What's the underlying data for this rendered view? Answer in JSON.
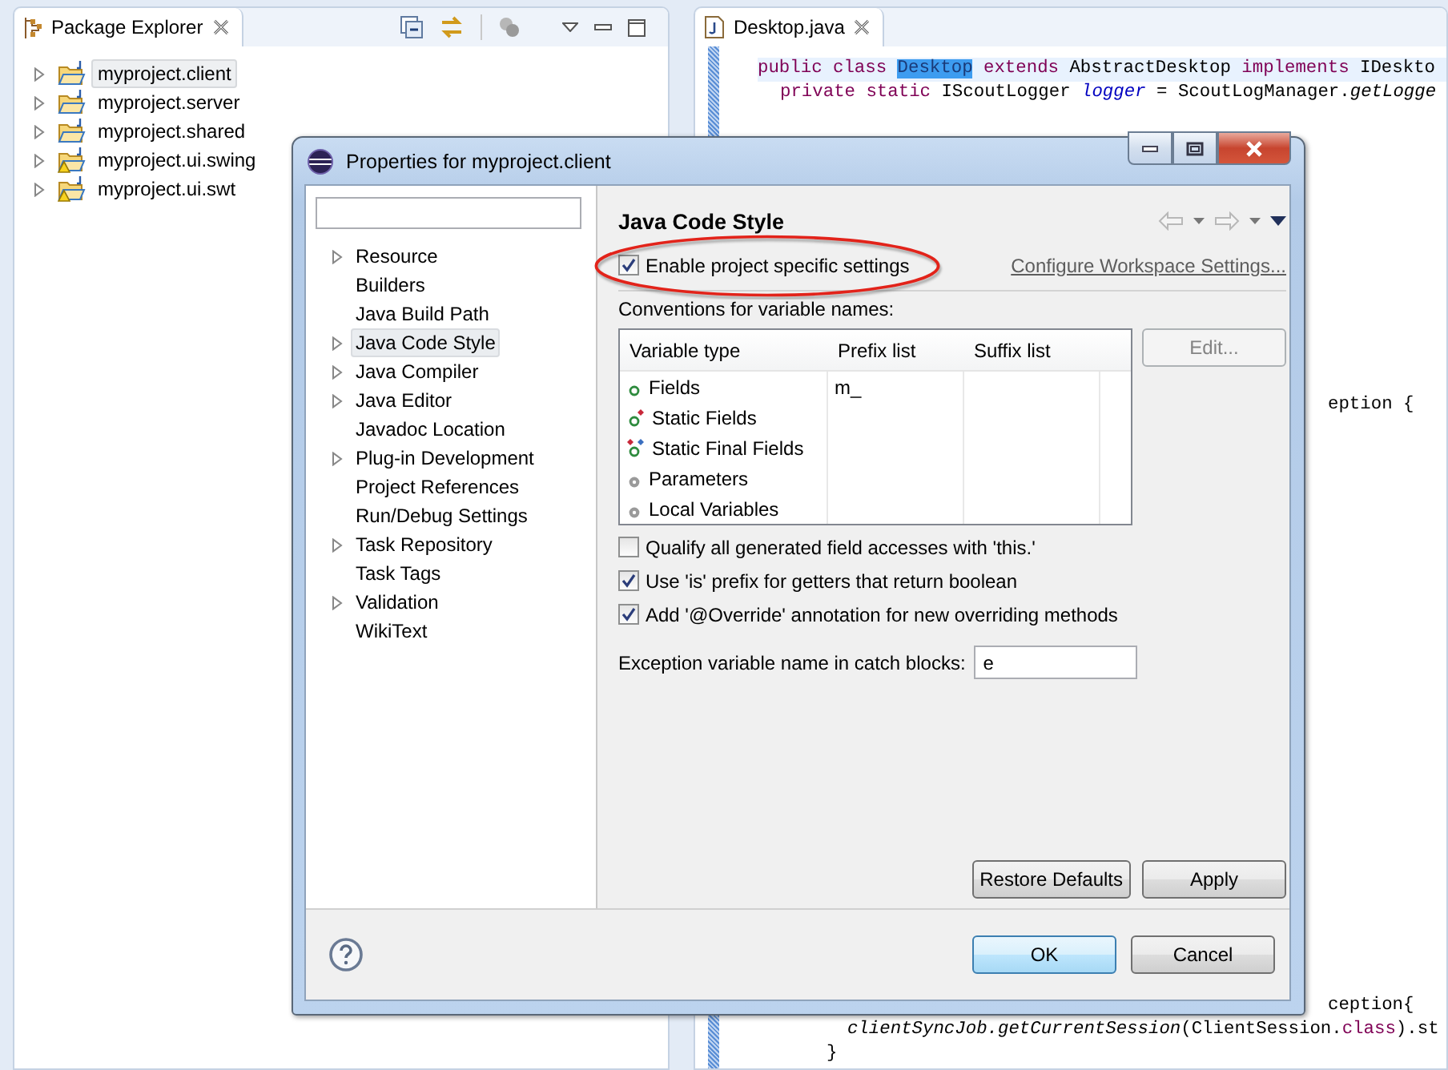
{
  "package_explorer": {
    "title": "Package Explorer",
    "items": [
      {
        "label": "myproject.client",
        "selected": true,
        "warning": false
      },
      {
        "label": "myproject.server",
        "selected": false,
        "warning": false
      },
      {
        "label": "myproject.shared",
        "selected": false,
        "warning": false
      },
      {
        "label": "myproject.ui.swing",
        "selected": false,
        "warning": true
      },
      {
        "label": "myproject.ui.swt",
        "selected": false,
        "warning": true
      }
    ]
  },
  "editor": {
    "tab": "Desktop.java",
    "lines": [
      {
        "current": true,
        "tokens": [
          {
            "kind": "keyword",
            "text": "public class "
          },
          {
            "kind": "selection",
            "text": "Desktop"
          },
          {
            "kind": "keyword",
            "text": " extends "
          },
          {
            "kind": "plain",
            "text": "AbstractDesktop "
          },
          {
            "kind": "keyword",
            "text": "implements "
          },
          {
            "kind": "plain",
            "text": "IDeskto"
          }
        ]
      },
      {
        "current": false,
        "tokens": [
          {
            "kind": "keyword",
            "text": "private static "
          },
          {
            "kind": "plain",
            "text": "IScoutLogger "
          },
          {
            "kind": "field",
            "text": "logger"
          },
          {
            "kind": "plain",
            "text": " = ScoutLogManager."
          },
          {
            "kind": "static-call",
            "text": "getLogge"
          }
        ]
      },
      {
        "current": false,
        "tokens": [
          {
            "kind": "plain",
            "text": "eption {"
          }
        ]
      },
      {
        "current": false,
        "tokens": [
          {
            "kind": "plain",
            "text": "ception{"
          }
        ]
      },
      {
        "current": false,
        "tokens": [
          {
            "kind": "static-call",
            "text": "clientSyncJob.getCurrentSession"
          },
          {
            "kind": "plain",
            "text": "(ClientSession."
          },
          {
            "kind": "keyword",
            "text": "class"
          },
          {
            "kind": "plain",
            "text": ").st"
          }
        ]
      },
      {
        "current": false,
        "tokens": [
          {
            "kind": "plain",
            "text": "}"
          }
        ]
      }
    ]
  },
  "dialog": {
    "title": "Properties for myproject.client",
    "tree": [
      {
        "label": "Resource",
        "has_children": true,
        "selected": false
      },
      {
        "label": "Builders",
        "has_children": false,
        "selected": false
      },
      {
        "label": "Java Build Path",
        "has_children": false,
        "selected": false
      },
      {
        "label": "Java Code Style",
        "has_children": true,
        "selected": true
      },
      {
        "label": "Java Compiler",
        "has_children": true,
        "selected": false
      },
      {
        "label": "Java Editor",
        "has_children": true,
        "selected": false
      },
      {
        "label": "Javadoc Location",
        "has_children": false,
        "selected": false
      },
      {
        "label": "Plug-in Development",
        "has_children": true,
        "selected": false
      },
      {
        "label": "Project References",
        "has_children": false,
        "selected": false
      },
      {
        "label": "Run/Debug Settings",
        "has_children": false,
        "selected": false
      },
      {
        "label": "Task Repository",
        "has_children": true,
        "selected": false
      },
      {
        "label": "Task Tags",
        "has_children": false,
        "selected": false
      },
      {
        "label": "Validation",
        "has_children": true,
        "selected": false
      },
      {
        "label": "WikiText",
        "has_children": false,
        "selected": false
      }
    ],
    "page_title": "Java Code Style",
    "project_specific": {
      "label": "Enable project specific settings",
      "checked": true
    },
    "configure_link": "Configure Workspace Settings...",
    "annotation": {
      "kind": "ellipse"
    },
    "conventions_label": "Conventions for variable names:",
    "table": {
      "columns": [
        "Variable type",
        "Prefix list",
        "Suffix list"
      ],
      "rows": [
        {
          "kind": "field",
          "name": "Fields",
          "prefix": "m_",
          "suffix": ""
        },
        {
          "kind": "static",
          "name": "Static Fields",
          "prefix": "",
          "suffix": ""
        },
        {
          "kind": "static-final",
          "name": "Static Final Fields",
          "prefix": "",
          "suffix": ""
        },
        {
          "kind": "parameter",
          "name": "Parameters",
          "prefix": "",
          "suffix": ""
        },
        {
          "kind": "local",
          "name": "Local Variables",
          "prefix": "",
          "suffix": ""
        }
      ]
    },
    "edit_button": {
      "label": "Edit...",
      "disabled": true
    },
    "options": [
      {
        "label": "Qualify all generated field accesses with 'this.'",
        "checked": false
      },
      {
        "label": "Use 'is' prefix for getters that return boolean",
        "checked": true
      },
      {
        "label": "Add '@Override' annotation for new overriding methods",
        "checked": true
      }
    ],
    "exception_label": "Exception variable name in catch blocks:",
    "exception_value": "e",
    "page_buttons": [
      {
        "label": "Restore Defaults",
        "default": false
      },
      {
        "label": "Apply",
        "default": false
      }
    ],
    "buttons": [
      {
        "label": "OK",
        "default": true
      },
      {
        "label": "Cancel",
        "default": false
      }
    ]
  }
}
